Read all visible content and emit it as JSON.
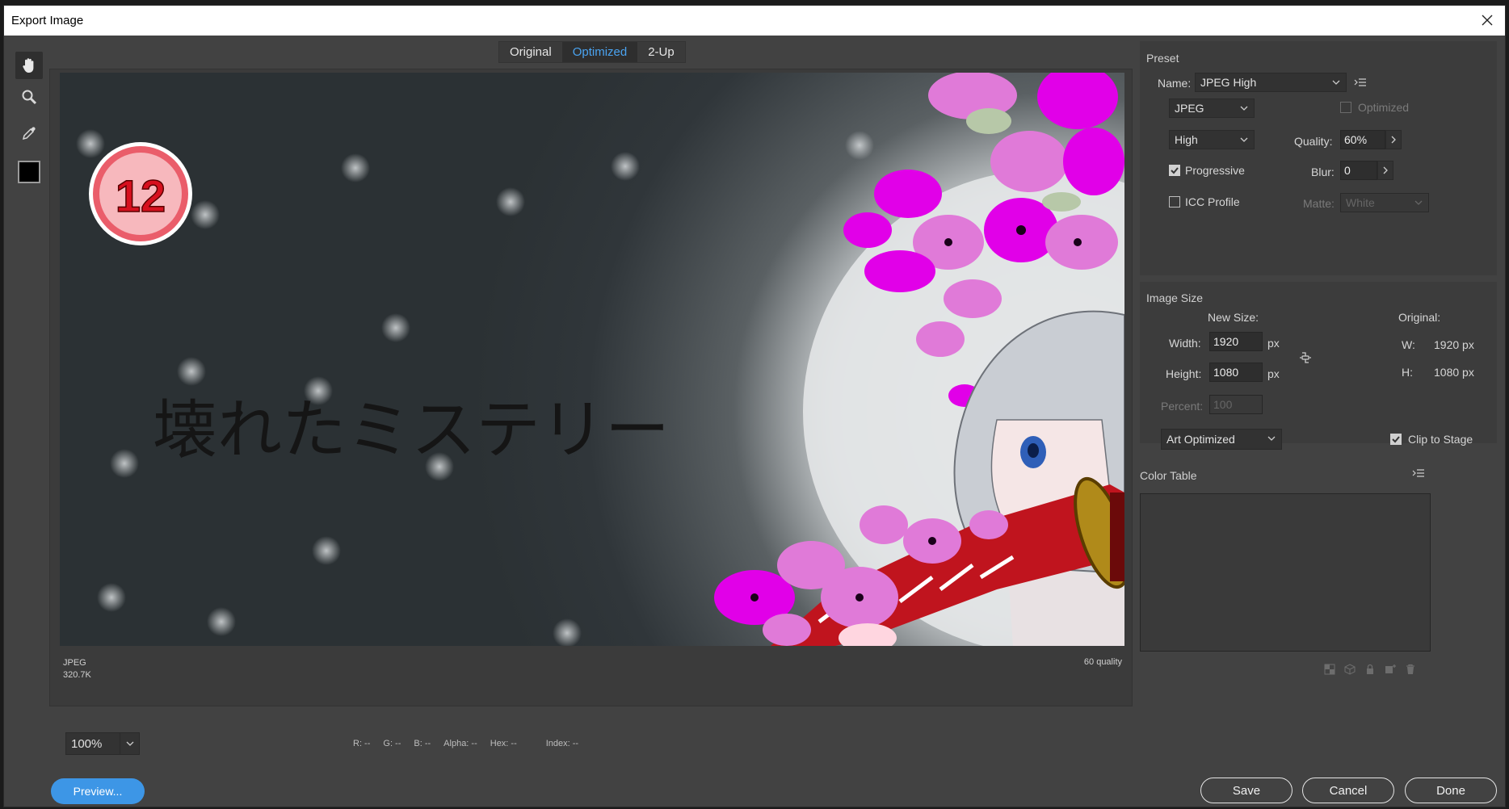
{
  "window": {
    "title": "Export Image"
  },
  "tools": [
    "hand-tool",
    "zoom-tool",
    "eyedropper-tool",
    "color-swatch"
  ],
  "view_tabs": [
    {
      "label": "Original",
      "active": false
    },
    {
      "label": "Optimized",
      "active": true
    },
    {
      "label": "2-Up",
      "active": false
    }
  ],
  "preview": {
    "badge_number": "12",
    "title_text": "壊れたミステリー",
    "format": "JPEG",
    "file_size": "320.7K",
    "quality_note": "60 quality"
  },
  "zoom": {
    "value": "100%"
  },
  "readouts": {
    "r": "R: --",
    "g": "G: --",
    "b": "B: --",
    "alpha": "Alpha: --",
    "hex": "Hex: --",
    "index": "Index: --"
  },
  "buttons": {
    "preview": "Preview...",
    "save": "Save",
    "cancel": "Cancel",
    "done": "Done"
  },
  "preset": {
    "section_title": "Preset",
    "name_label": "Name:",
    "name_value": "JPEG High",
    "format_value": "JPEG",
    "optimized_label": "Optimized",
    "optimized_checked": false,
    "quality_level": "High",
    "quality_label": "Quality:",
    "quality_value": "60%",
    "progressive_label": "Progressive",
    "progressive_checked": true,
    "blur_label": "Blur:",
    "blur_value": "0",
    "icc_label": "ICC Profile",
    "icc_checked": false,
    "matte_label": "Matte:",
    "matte_value": "White"
  },
  "image_size": {
    "section_title": "Image Size",
    "new_size_label": "New Size:",
    "original_label": "Original:",
    "width_label": "Width:",
    "width_value": "1920",
    "height_label": "Height:",
    "height_value": "1080",
    "unit": "px",
    "orig_w_label": "W:",
    "orig_w_value": "1920 px",
    "orig_h_label": "H:",
    "orig_h_value": "1080 px",
    "percent_label": "Percent:",
    "percent_value": "100",
    "resample_value": "Art Optimized",
    "clip_label": "Clip to Stage",
    "clip_checked": true
  },
  "color_table": {
    "section_title": "Color Table"
  },
  "colors": {
    "accent": "#3d96e6",
    "active_tab_text": "#4aa3f0",
    "panel_bg": "#424242",
    "magenta_flower": "#e100e8",
    "pink_flower": "#e07ad8",
    "sword_red": "#c0141e"
  }
}
